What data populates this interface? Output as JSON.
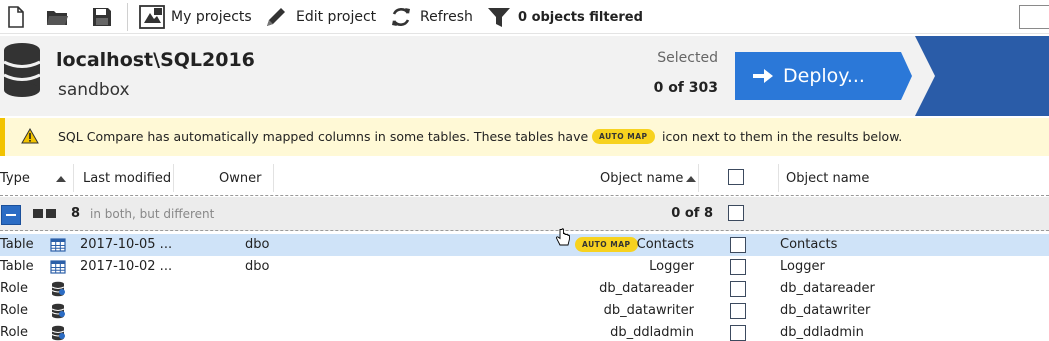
{
  "toolbar": {
    "my_projects": "My projects",
    "edit_project": "Edit project",
    "refresh": "Refresh",
    "filter_status": "0 objects filtered"
  },
  "header": {
    "server": "localhost\\SQL2016",
    "database": "sandbox",
    "selected_label": "Selected",
    "selected_count": "0 of 303",
    "deploy_label": "Deploy..."
  },
  "banner": {
    "text_before": "SQL Compare has automatically mapped columns in some tables. These tables have an",
    "badge": "AUTO MAP",
    "text_after": "icon next to them in the results below."
  },
  "columns": {
    "type": "Type",
    "last_modified": "Last modified",
    "owner": "Owner",
    "object_name_left": "Object name",
    "object_name_right": "Object name"
  },
  "group": {
    "count": "8",
    "label": "in both, but different",
    "selected": "0 of 8"
  },
  "rows": [
    {
      "type": "Table",
      "icon": "table-icon",
      "modified": "2017-10-05 ...",
      "owner": "dbo",
      "badge": "AUTO MAP",
      "left_name": "Contacts",
      "right_name": "Contacts"
    },
    {
      "type": "Table",
      "icon": "table-icon",
      "modified": "2017-10-02 ...",
      "owner": "dbo",
      "left_name": "Logger",
      "right_name": "Logger"
    },
    {
      "type": "Role",
      "icon": "role-icon",
      "modified": "",
      "owner": "",
      "left_name": "db_datareader",
      "right_name": "db_datareader"
    },
    {
      "type": "Role",
      "icon": "role-icon",
      "modified": "",
      "owner": "",
      "left_name": "db_datawriter",
      "right_name": "db_datawriter"
    },
    {
      "type": "Role",
      "icon": "role-icon",
      "modified": "",
      "owner": "",
      "left_name": "db_ddladmin",
      "right_name": "db_ddladmin"
    }
  ],
  "colors": {
    "deploy_blue": "#2b78d8",
    "deploy_dark": "#2a5ca8",
    "banner_bg": "#fff9d6",
    "automap_yellow": "#f7d21f",
    "selected_row": "#cfe3f8"
  }
}
